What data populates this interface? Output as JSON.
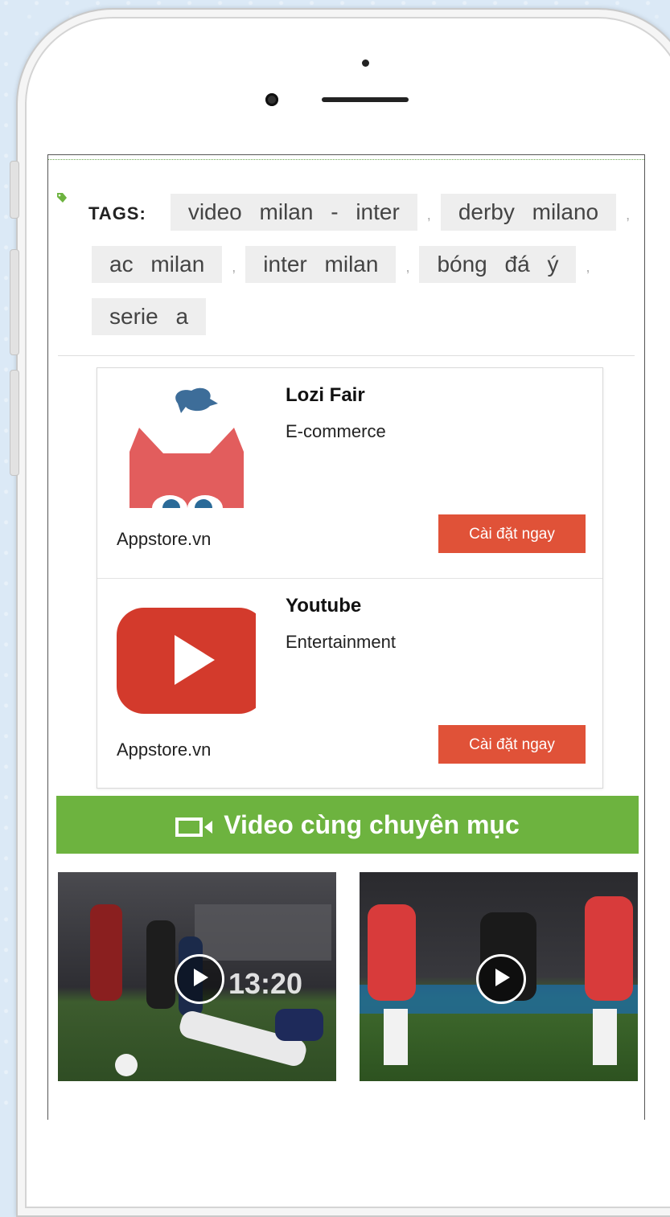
{
  "tags": {
    "label": "TAGS:",
    "items": [
      "video milan - inter",
      "derby milano",
      "ac milan",
      "inter milan",
      "bóng đá ý",
      "serie a"
    ],
    "separator": ","
  },
  "apps": [
    {
      "name": "Lozi Fair",
      "category": "E-commerce",
      "source": "Appstore.vn",
      "button": "Cài đặt ngay",
      "icon": "lozi-cat-icon"
    },
    {
      "name": "Youtube",
      "category": "Entertainment",
      "source": "Appstore.vn",
      "button": "Cài đặt ngay",
      "icon": "youtube-play-icon"
    }
  ],
  "video_section": {
    "title": "Video cùng chuyên mục",
    "icon": "video-camera-icon",
    "thumb1_overlay": "13:20"
  },
  "colors": {
    "accent_green": "#6db33f",
    "install_red": "#e05238",
    "tag_bg": "#eeeeee"
  }
}
